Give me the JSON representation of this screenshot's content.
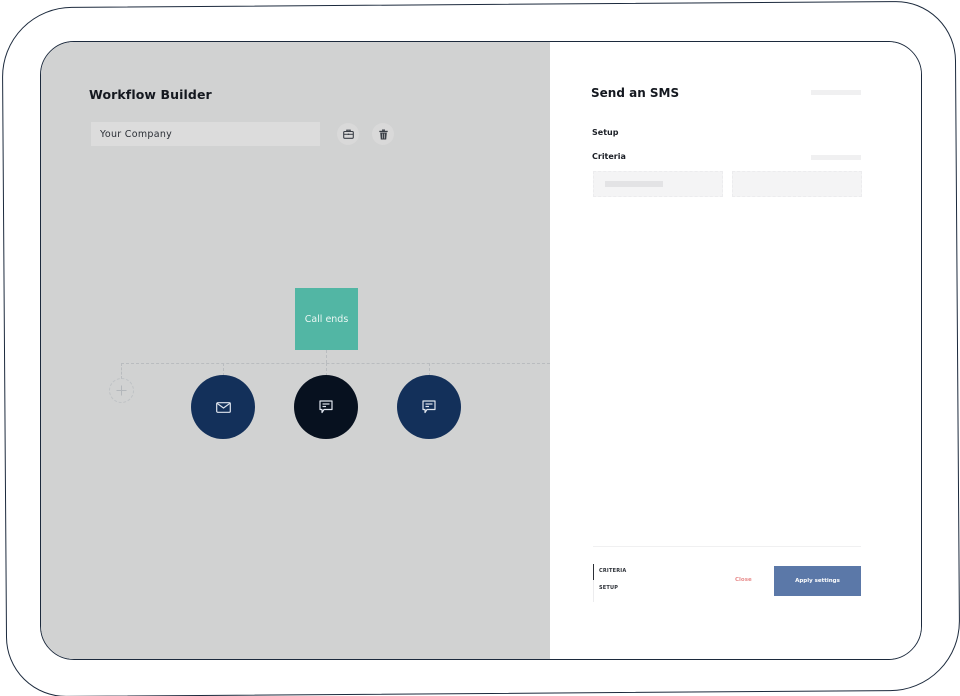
{
  "canvas": {
    "title": "Workflow Builder",
    "company_input": {
      "value": "Your Company",
      "placeholder": ""
    },
    "toolbar": [
      {
        "name": "briefcase-icon",
        "action": "business-settings"
      },
      {
        "name": "trash-icon",
        "action": "delete"
      }
    ],
    "flow": {
      "trigger": {
        "label": "Call ends",
        "color": "#52b6a4"
      },
      "actions": [
        {
          "type": "email",
          "icon": "mail-icon",
          "color": "#13305a",
          "selected": false
        },
        {
          "type": "sms",
          "icon": "message-icon",
          "color": "#07111f",
          "selected": true
        },
        {
          "type": "sms",
          "icon": "message-icon",
          "color": "#13305a",
          "selected": false
        }
      ],
      "add_icon": "plus-icon"
    }
  },
  "panel": {
    "title": "Send an SMS",
    "sections": {
      "setup": "Setup",
      "criteria": "Criteria"
    },
    "footer": {
      "nav": [
        "CRITERIA",
        "SETUP"
      ],
      "active_nav": "CRITERIA",
      "close_label": "Close",
      "apply_label": "Apply settings"
    }
  },
  "colors": {
    "canvas_bg": "#d1d2d2",
    "trigger": "#52b6a4",
    "node_navy": "#13305a",
    "node_selected": "#07111f",
    "apply_button": "#5b78a8",
    "close_link": "#e88c8c"
  }
}
